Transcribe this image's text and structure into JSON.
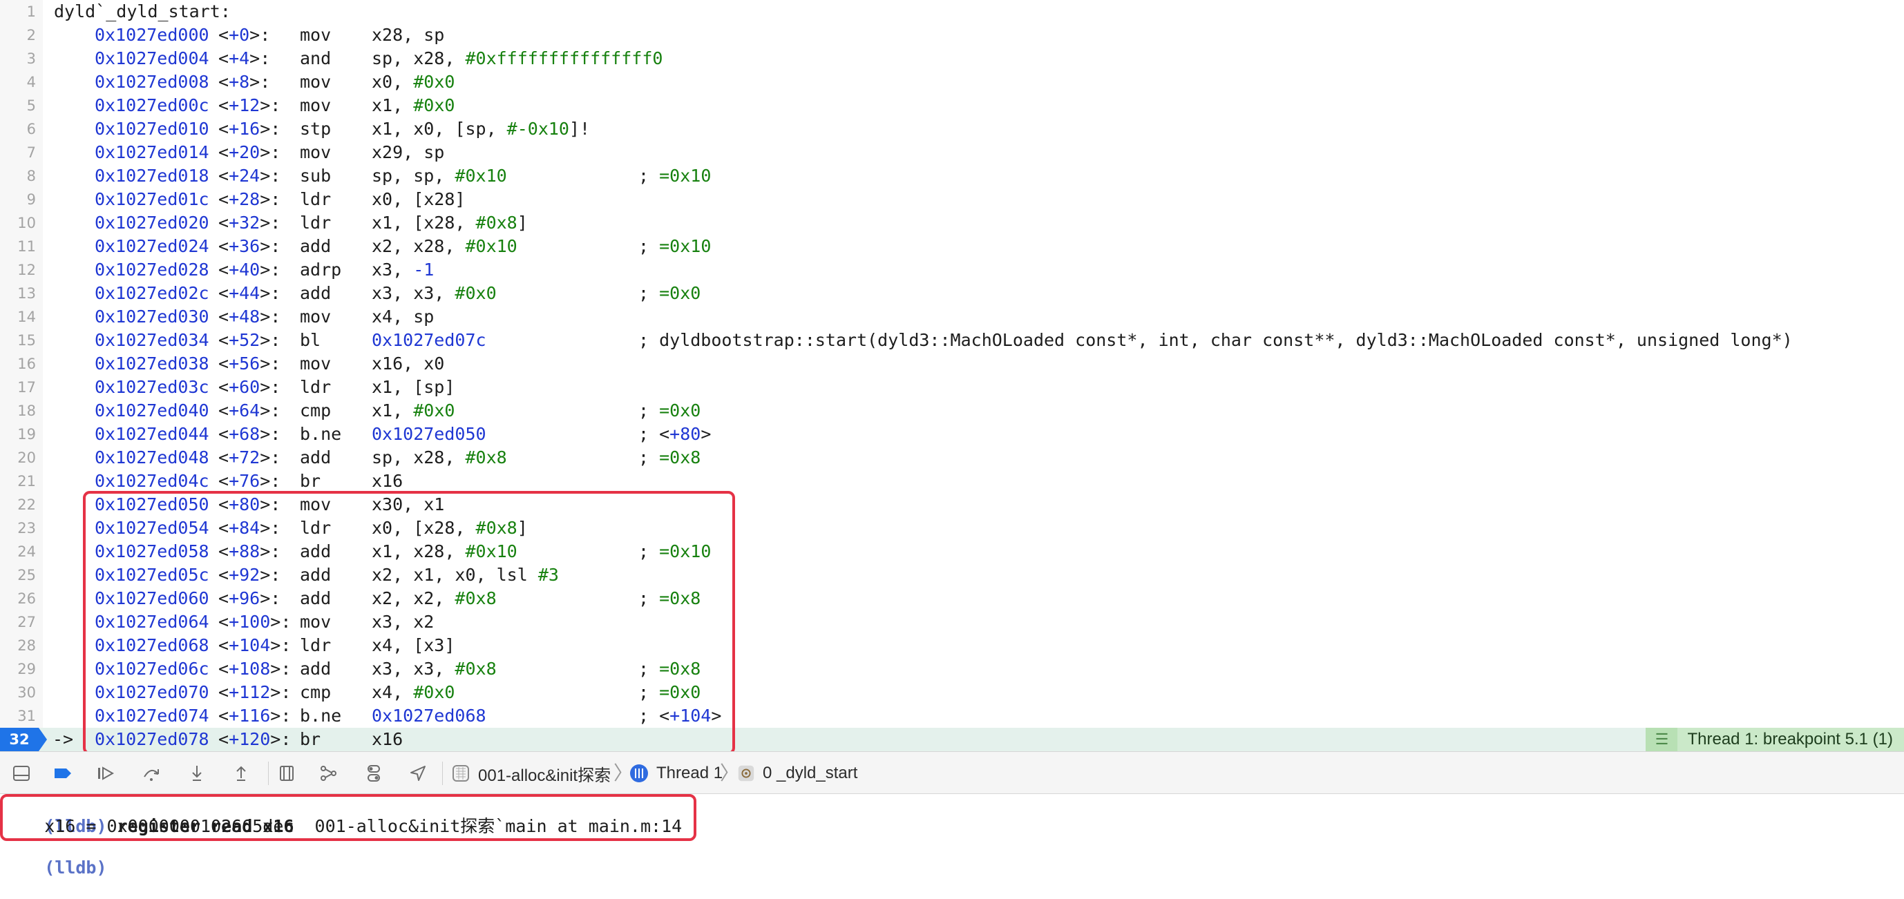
{
  "editor": {
    "title_line": {
      "num": "1",
      "text": "dyld`_dyld_start:"
    },
    "lines": [
      {
        "num": "2",
        "addr": "0x1027ed000",
        "off": "+0",
        "mn": "mov",
        "ops": [
          [
            "x28, sp",
            ""
          ]
        ],
        "comment": ""
      },
      {
        "num": "3",
        "addr": "0x1027ed004",
        "off": "+4",
        "mn": "and",
        "ops": [
          [
            "sp, x28, ",
            ""
          ],
          [
            "#0xfffffffffffffff0",
            "imm"
          ]
        ],
        "comment": ""
      },
      {
        "num": "4",
        "addr": "0x1027ed008",
        "off": "+8",
        "mn": "mov",
        "ops": [
          [
            "x0, ",
            ""
          ],
          [
            "#0x0",
            "imm"
          ]
        ],
        "comment": ""
      },
      {
        "num": "5",
        "addr": "0x1027ed00c",
        "off": "+12",
        "mn": "mov",
        "ops": [
          [
            "x1, ",
            ""
          ],
          [
            "#0x0",
            "imm"
          ]
        ],
        "comment": ""
      },
      {
        "num": "6",
        "addr": "0x1027ed010",
        "off": "+16",
        "mn": "stp",
        "ops": [
          [
            "x1, x0, [sp, ",
            ""
          ],
          [
            "#-0x10",
            "imm"
          ],
          [
            "]!",
            ""
          ]
        ],
        "comment": ""
      },
      {
        "num": "7",
        "addr": "0x1027ed014",
        "off": "+20",
        "mn": "mov",
        "ops": [
          [
            "x29, sp",
            ""
          ]
        ],
        "comment": ""
      },
      {
        "num": "8",
        "addr": "0x1027ed018",
        "off": "+24",
        "mn": "sub",
        "ops": [
          [
            "sp, sp, ",
            ""
          ],
          [
            "#0x10",
            "imm"
          ]
        ],
        "comment": "; =0x10",
        "comment_style": "imm"
      },
      {
        "num": "9",
        "addr": "0x1027ed01c",
        "off": "+28",
        "mn": "ldr",
        "ops": [
          [
            "x0, [x28]",
            ""
          ]
        ],
        "comment": ""
      },
      {
        "num": "10",
        "addr": "0x1027ed020",
        "off": "+32",
        "mn": "ldr",
        "ops": [
          [
            "x1, [x28, ",
            ""
          ],
          [
            "#0x8",
            "imm"
          ],
          [
            "]",
            ""
          ]
        ],
        "comment": ""
      },
      {
        "num": "11",
        "addr": "0x1027ed024",
        "off": "+36",
        "mn": "add",
        "ops": [
          [
            "x2, x28, ",
            ""
          ],
          [
            "#0x10",
            "imm"
          ]
        ],
        "comment": "; =0x10",
        "comment_style": "imm"
      },
      {
        "num": "12",
        "addr": "0x1027ed028",
        "off": "+40",
        "mn": "adrp",
        "ops": [
          [
            "x3, ",
            ""
          ],
          [
            "-1",
            "blue"
          ]
        ],
        "comment": ""
      },
      {
        "num": "13",
        "addr": "0x1027ed02c",
        "off": "+44",
        "mn": "add",
        "ops": [
          [
            "x3, x3, ",
            ""
          ],
          [
            "#0x0",
            "imm"
          ]
        ],
        "comment": "; =0x0",
        "comment_style": "imm"
      },
      {
        "num": "14",
        "addr": "0x1027ed030",
        "off": "+48",
        "mn": "mov",
        "ops": [
          [
            "x4, sp",
            ""
          ]
        ],
        "comment": ""
      },
      {
        "num": "15",
        "addr": "0x1027ed034",
        "off": "+52",
        "mn": "bl",
        "ops": [
          [
            "0x1027ed07c",
            "blue"
          ]
        ],
        "comment": "; dyldbootstrap::start(dyld3::MachOLoaded const*, int, char const**, dyld3::MachOLoaded const*, unsigned long*)",
        "comment_style": ""
      },
      {
        "num": "16",
        "addr": "0x1027ed038",
        "off": "+56",
        "mn": "mov",
        "ops": [
          [
            "x16, x0",
            ""
          ]
        ],
        "comment": ""
      },
      {
        "num": "17",
        "addr": "0x1027ed03c",
        "off": "+60",
        "mn": "ldr",
        "ops": [
          [
            "x1, [sp]",
            ""
          ]
        ],
        "comment": ""
      },
      {
        "num": "18",
        "addr": "0x1027ed040",
        "off": "+64",
        "mn": "cmp",
        "ops": [
          [
            "x1, ",
            ""
          ],
          [
            "#0x0",
            "imm"
          ]
        ],
        "comment": "; =0x0",
        "comment_style": "imm"
      },
      {
        "num": "19",
        "addr": "0x1027ed044",
        "off": "+68",
        "mn": "b.ne",
        "ops": [
          [
            "0x1027ed050",
            "blue"
          ]
        ],
        "comment": "; <+80>",
        "comment_style": "ref"
      },
      {
        "num": "20",
        "addr": "0x1027ed048",
        "off": "+72",
        "mn": "add",
        "ops": [
          [
            "sp, x28, ",
            ""
          ],
          [
            "#0x8",
            "imm"
          ]
        ],
        "comment": "; =0x8",
        "comment_style": "imm"
      },
      {
        "num": "21",
        "addr": "0x1027ed04c",
        "off": "+76",
        "mn": "br",
        "ops": [
          [
            "x16",
            ""
          ]
        ],
        "comment": ""
      },
      {
        "num": "22",
        "addr": "0x1027ed050",
        "off": "+80",
        "mn": "mov",
        "ops": [
          [
            "x30, x1",
            ""
          ]
        ],
        "comment": ""
      },
      {
        "num": "23",
        "addr": "0x1027ed054",
        "off": "+84",
        "mn": "ldr",
        "ops": [
          [
            "x0, [x28, ",
            ""
          ],
          [
            "#0x8",
            "imm"
          ],
          [
            "]",
            ""
          ]
        ],
        "comment": ""
      },
      {
        "num": "24",
        "addr": "0x1027ed058",
        "off": "+88",
        "mn": "add",
        "ops": [
          [
            "x1, x28, ",
            ""
          ],
          [
            "#0x10",
            "imm"
          ]
        ],
        "comment": "; =0x10",
        "comment_style": "imm"
      },
      {
        "num": "25",
        "addr": "0x1027ed05c",
        "off": "+92",
        "mn": "add",
        "ops": [
          [
            "x2, x1, x0, lsl ",
            ""
          ],
          [
            "#3",
            "imm"
          ]
        ],
        "comment": ""
      },
      {
        "num": "26",
        "addr": "0x1027ed060",
        "off": "+96",
        "mn": "add",
        "ops": [
          [
            "x2, x2, ",
            ""
          ],
          [
            "#0x8",
            "imm"
          ]
        ],
        "comment": "; =0x8",
        "comment_style": "imm"
      },
      {
        "num": "27",
        "addr": "0x1027ed064",
        "off": "+100",
        "mn": "mov",
        "ops": [
          [
            "x3, x2",
            ""
          ]
        ],
        "comment": ""
      },
      {
        "num": "28",
        "addr": "0x1027ed068",
        "off": "+104",
        "mn": "ldr",
        "ops": [
          [
            "x4, [x3]",
            ""
          ]
        ],
        "comment": ""
      },
      {
        "num": "29",
        "addr": "0x1027ed06c",
        "off": "+108",
        "mn": "add",
        "ops": [
          [
            "x3, x3, ",
            ""
          ],
          [
            "#0x8",
            "imm"
          ]
        ],
        "comment": "; =0x8",
        "comment_style": "imm"
      },
      {
        "num": "30",
        "addr": "0x1027ed070",
        "off": "+112",
        "mn": "cmp",
        "ops": [
          [
            "x4, ",
            ""
          ],
          [
            "#0x0",
            "imm"
          ]
        ],
        "comment": "; =0x0",
        "comment_style": "imm"
      },
      {
        "num": "31",
        "addr": "0x1027ed074",
        "off": "+116",
        "mn": "b.ne",
        "ops": [
          [
            "0x1027ed068",
            "blue"
          ]
        ],
        "comment": "; <+104>",
        "comment_style": "ref"
      }
    ],
    "current_line": {
      "num": "32",
      "arrow": "->",
      "addr": "0x1027ed078",
      "off": "+120",
      "mn": "br",
      "ops": [
        [
          "x16",
          ""
        ]
      ],
      "comment": ""
    },
    "breakpoint_badge": "Thread 1: breakpoint 5.1 (1)"
  },
  "debugbar": {
    "buttons": [
      "hide-debug-area",
      "breakpoints-toggle",
      "continue",
      "step-over",
      "step-into",
      "step-out",
      "debug-view-hierarchy",
      "memory-graph",
      "environment-overrides",
      "simulate-location"
    ],
    "breadcrumb": {
      "target": "001-alloc&init探索",
      "thread": "Thread 1",
      "frame": "0 _dyld_start"
    }
  },
  "console": {
    "prompt": "(lldb)",
    "command": "register read x16",
    "output": "    x16 = 0x0000000102665dec  001-alloc&init探索`main at main.m:14",
    "final_prompt": "(lldb)"
  },
  "colors": {
    "address": "#1f37d3",
    "immediate": "#17810f",
    "highlight_box": "#e53246",
    "current_line_bg": "#e4f1ec",
    "line_pill": "#1f74e8",
    "badge_bg": "#cbe9c9"
  }
}
